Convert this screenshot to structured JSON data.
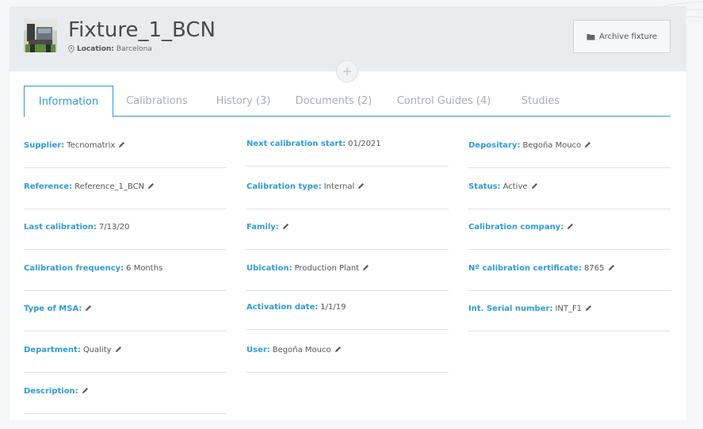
{
  "header": {
    "title": "Fixture_1_BCN",
    "location_label": "Location:",
    "location_value": "Barcelona",
    "archive_label": "Archive fixture"
  },
  "tabs": [
    {
      "label": "Information",
      "active": true
    },
    {
      "label": "Calibrations",
      "active": false
    },
    {
      "label": "History (3)",
      "active": false
    },
    {
      "label": "Documents (2)",
      "active": false
    },
    {
      "label": "Control Guides (4)",
      "active": false
    },
    {
      "label": "Studies",
      "active": false
    }
  ],
  "fields": {
    "col1": [
      {
        "label": "Supplier:",
        "value": "Tecnomatrix",
        "editable": true
      },
      {
        "label": "Reference:",
        "value": "Reference_1_BCN",
        "editable": true
      },
      {
        "label": "Last calibration:",
        "value": "7/13/20",
        "editable": false
      },
      {
        "label": "Calibration frequency:",
        "value": "6 Months",
        "editable": false
      },
      {
        "label": "Type of MSA:",
        "value": "",
        "editable": true
      },
      {
        "label": "Department:",
        "value": "Quality",
        "editable": true
      },
      {
        "label": "Description:",
        "value": "",
        "editable": true
      }
    ],
    "col2": [
      {
        "label": "Next calibration start:",
        "value": "01/2021",
        "editable": false
      },
      {
        "label": "Calibration type:",
        "value": "Internal",
        "editable": true
      },
      {
        "label": "Family:",
        "value": "",
        "editable": true
      },
      {
        "label": "Ubication:",
        "value": "Production Plant",
        "editable": true
      },
      {
        "label": "Activation date:",
        "value": "1/1/19",
        "editable": false
      },
      {
        "label": "User:",
        "value": "Begoña Mouco",
        "editable": true
      }
    ],
    "col3": [
      {
        "label": "Depositary:",
        "value": "Begoña Mouco",
        "editable": true
      },
      {
        "label": "Status:",
        "value": "Active",
        "editable": true
      },
      {
        "label": "Calibration company:",
        "value": "",
        "editable": true
      },
      {
        "label": "Nº calibration certificate:",
        "value": "8765",
        "editable": true
      },
      {
        "label": "Int. Serial number:",
        "value": "INT_F1",
        "editable": true
      }
    ]
  },
  "colors": {
    "accent": "#2f9bd8",
    "header_bg": "#e9ecef",
    "muted_tab": "#a7adb3"
  },
  "icons": {
    "location": "map-pin-icon",
    "archive": "folder-icon",
    "add": "plus-icon",
    "edit": "pencil-icon"
  }
}
